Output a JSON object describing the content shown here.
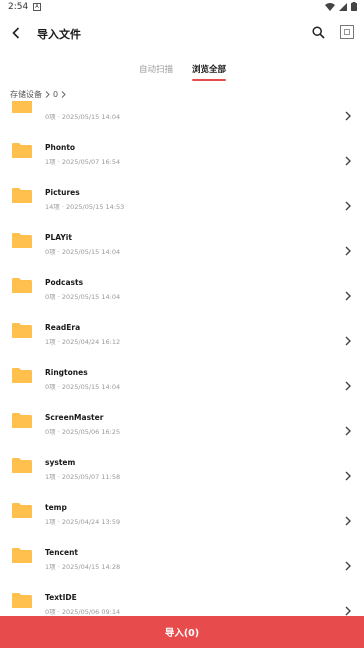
{
  "status_bar": {
    "time": "2:54",
    "notif_glyph": "A"
  },
  "header": {
    "title": "导入文件"
  },
  "tabs": [
    {
      "label": "自动扫描",
      "active": false
    },
    {
      "label": "浏览全部",
      "active": true
    }
  ],
  "breadcrumb": {
    "items": [
      "存储设备",
      "0"
    ]
  },
  "files": [
    {
      "name": "",
      "count": "0项",
      "date": "2025/05/15 14:04"
    },
    {
      "name": "Phonto",
      "count": "1项",
      "date": "2025/05/07 16:54"
    },
    {
      "name": "Pictures",
      "count": "14项",
      "date": "2025/05/15 14:53"
    },
    {
      "name": "PLAYit",
      "count": "0项",
      "date": "2025/05/15 14:04"
    },
    {
      "name": "Podcasts",
      "count": "0项",
      "date": "2025/05/15 14:04"
    },
    {
      "name": "ReadEra",
      "count": "1项",
      "date": "2025/04/24 16:12"
    },
    {
      "name": "Ringtones",
      "count": "0项",
      "date": "2025/05/15 14:04"
    },
    {
      "name": "ScreenMaster",
      "count": "0项",
      "date": "2025/05/06 16:25"
    },
    {
      "name": "system",
      "count": "1项",
      "date": "2025/05/07 11:58"
    },
    {
      "name": "temp",
      "count": "1项",
      "date": "2025/04/24 13:59"
    },
    {
      "name": "Tencent",
      "count": "1项",
      "date": "2025/04/15 14:28"
    },
    {
      "name": "TextIDE",
      "count": "0项",
      "date": "2025/05/06 09:14"
    }
  ],
  "import_button": {
    "label": "导入(0)"
  },
  "colors": {
    "accent": "#e84b4b",
    "folder": "#ffbf4d"
  },
  "icons": {
    "back": "back-arrow-icon",
    "search": "search-icon",
    "select_all": "select-all-icon",
    "folder": "folder-icon",
    "chevron": "chevron-right-icon"
  }
}
